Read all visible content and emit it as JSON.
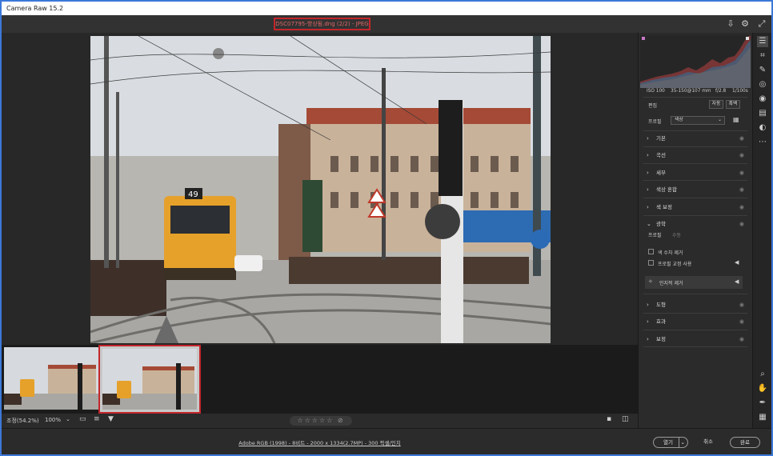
{
  "window": {
    "title": "Camera Raw 15.2"
  },
  "topbar": {
    "file_title": "DSC07795-향상됨.dng (2/2)  -  JPEG"
  },
  "filmstrip": {
    "thumbs": [
      "thumb-1",
      "thumb-2"
    ],
    "selected_index": 1
  },
  "bottombar": {
    "zoom_label": "조정(54.2%)",
    "zoom_pct": "100%",
    "rating_stars": "☆☆☆☆☆",
    "reject": "⊘"
  },
  "footer": {
    "info_link": "Adobe RGB (1998) - 8비트 - 2000 x 1334(2.7MP) - 300 픽셀/인치",
    "open_label": "열기",
    "cancel_label": "취소",
    "done_label": "완료"
  },
  "histogram_meta": {
    "iso": "ISO 100",
    "lens": "35-150@107 mm",
    "aperture": "f/2.8",
    "shutter": "1/100s"
  },
  "panel": {
    "edit_label": "편집",
    "auto_label": "자동",
    "bw_label": "흑백",
    "profile_label": "프로필",
    "profile_value": "색상",
    "sections": [
      {
        "label": "기본"
      },
      {
        "label": "곡선"
      },
      {
        "label": "세부"
      },
      {
        "label": "색상 혼합"
      },
      {
        "label": "색 보정"
      }
    ],
    "optics": {
      "label": "광학",
      "tab_profile": "프로필",
      "tab_manual": "수동",
      "remove_ca": "색 수차 제거",
      "use_profile": "프로필 교정 사용",
      "distraction_removal": "인지적 제거"
    },
    "sections_after": [
      {
        "label": "도형"
      },
      {
        "label": "효과"
      },
      {
        "label": "보정"
      }
    ]
  },
  "colors": {
    "accent_red": "#c3262c",
    "window_border": "#3c78d8",
    "panel_bg": "#2b2b2b"
  }
}
